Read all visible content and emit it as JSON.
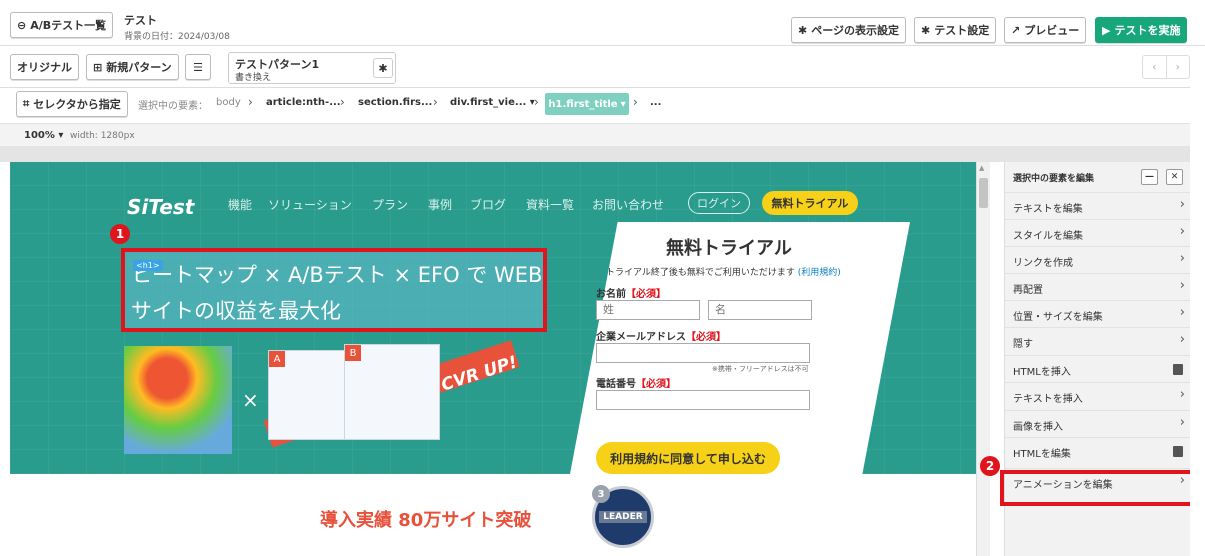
{
  "topbar": {
    "ab_list_button": "A/Bテスト一覧",
    "test_name": "テスト",
    "date_line": "背景の日付：2024/03/08",
    "page_settings": "ページの表示設定",
    "test_settings": "テスト設定",
    "preview": "プレビュー",
    "run_test": "テストを実施"
  },
  "pattern_bar": {
    "original": "オリジナル",
    "new_pattern": "新規パターン",
    "pattern_name": "テストパターン1",
    "pattern_sub": "書き換え"
  },
  "selector_bar": {
    "select_button": "セレクタから指定",
    "selected_label": "選択中の要素：",
    "crumbs": [
      "body",
      "article:nth-...",
      "section.firs...",
      "div.first_vie...",
      "h1.first_title",
      "..."
    ]
  },
  "zoom": {
    "level": "100%",
    "width": "width: 1280px"
  },
  "site": {
    "logo": "SiTest",
    "nav": [
      "機能",
      "ソリューション",
      "プラン",
      "事例",
      "ブログ",
      "資料一覧",
      "お問い合わせ"
    ],
    "login": "ログイン",
    "trial": "無料トライアル",
    "h1_tag": "<h1>",
    "h1_text": "ヒートマップ × A/Bテスト × EFO で WEBサイトの収益を最大化",
    "times": "×",
    "ab_a": "A",
    "ab_b": "B",
    "cvr": "CVR UP!",
    "form": {
      "title": "無料トライアル",
      "note": "トライアル終了後も無料でご利用いただけます",
      "note_link": "(利用規約)",
      "name_label": "お名前",
      "required": "【必須】",
      "first_placeholder": "姓",
      "last_placeholder": "名",
      "email_label": "企業メールアドレス",
      "email_hint": "※携帯・フリーアドレスは不可",
      "phone_label": "電話番号",
      "submit": "利用規約に同意して申し込む"
    },
    "record": "導入実績 80万サイト突破",
    "leader_badge": "LEADER",
    "leader_num": "3"
  },
  "panel": {
    "title": "選択中の要素を編集",
    "items": [
      {
        "label": "テキストを編集",
        "icon": "chevron-right"
      },
      {
        "label": "スタイルを編集",
        "icon": "chevron-right"
      },
      {
        "label": "リンクを作成",
        "icon": "chevron-right"
      },
      {
        "label": "再配置",
        "icon": "chevron-right"
      },
      {
        "label": "位置・サイズを編集",
        "icon": "chevron-right"
      },
      {
        "label": "隠す",
        "icon": "chevron-right"
      },
      {
        "label": "HTMLを挿入",
        "icon": "copy"
      },
      {
        "label": "テキストを挿入",
        "icon": "chevron-right"
      },
      {
        "label": "画像を挿入",
        "icon": "chevron-right"
      },
      {
        "label": "HTMLを編集",
        "icon": "copy"
      },
      {
        "label": "アニメーションを編集",
        "icon": "chevron-right"
      }
    ]
  },
  "annotations": {
    "badge1": "1",
    "badge2": "2"
  },
  "colors": {
    "accent": "#17a77b",
    "highlight": "#e0141c",
    "hero_bg": "#2a9c8d",
    "cta": "#f7d117"
  }
}
